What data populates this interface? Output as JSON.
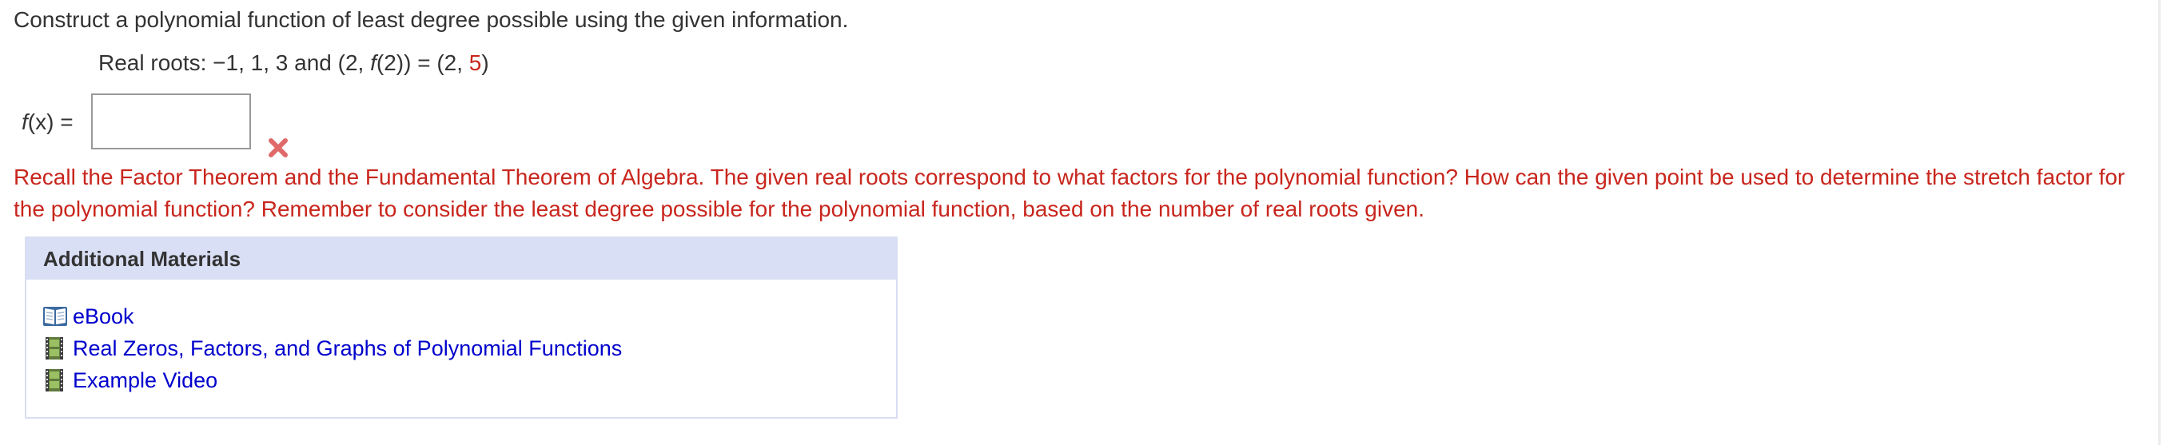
{
  "question": {
    "instruction": "Construct a polynomial function of least degree possible using the given information.",
    "given_prefix": "Real roots: −1, 1, 3 and (2, ",
    "given_func": "f",
    "given_middle": "(2)) = (2, ",
    "given_value": "5",
    "given_suffix": ")"
  },
  "answer": {
    "label_func": "f",
    "label_rest": "(x) =",
    "value": "",
    "status_icon": "incorrect-x-icon"
  },
  "hint": {
    "text": "Recall the Factor Theorem and the Fundamental Theorem of Algebra. The given real roots correspond to what factors for the polynomial function? How can the given point be used to determine the stretch factor for the polynomial function? Remember to consider the least degree possible for the polynomial function, based on the number of real roots given."
  },
  "materials": {
    "title": "Additional Materials",
    "items": [
      {
        "label": "eBook",
        "icon": "book-icon"
      },
      {
        "label": "Real Zeros, Factors, and Graphs of Polynomial Functions",
        "icon": "film-icon"
      },
      {
        "label": "Example Video",
        "icon": "film-icon"
      }
    ]
  },
  "colors": {
    "hint_red": "#c8261d",
    "link_blue": "#0000cc",
    "header_bg": "#d9dff5",
    "x_mark": "#e06a6a"
  }
}
